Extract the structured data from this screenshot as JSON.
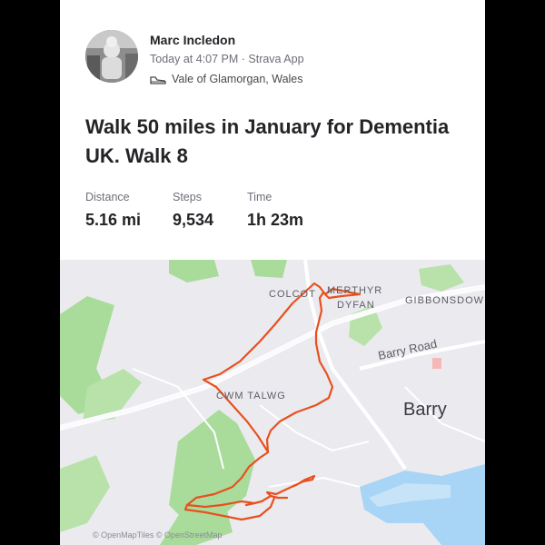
{
  "activity": {
    "athlete_name": "Marc Incledon",
    "meta": "Today at 4:07 PM · Strava App",
    "location": "Vale of Glamorgan, Wales",
    "title": "Walk 50 miles in January for Dementia UK. Walk 8",
    "stats": [
      {
        "label": "Distance",
        "value": "5.16 mi"
      },
      {
        "label": "Steps",
        "value": "9,534"
      },
      {
        "label": "Time",
        "value": "1h 23m"
      }
    ]
  },
  "map": {
    "labels": {
      "colcot": "COLCOT",
      "merthyr": "MERTHYR",
      "dyfan": "DYFAN",
      "gibbonsdown": "GIBBONSDOW",
      "cwm_talwg": "CWM TALWG",
      "barry_road": "Barry Road",
      "barry": "Barry"
    },
    "attribution": "© OpenMapTiles © OpenStreetMap"
  },
  "colors": {
    "accent": "#fc5200",
    "route": "#e8501e",
    "park": "#a9dc9b",
    "water": "#a8d4f5"
  }
}
